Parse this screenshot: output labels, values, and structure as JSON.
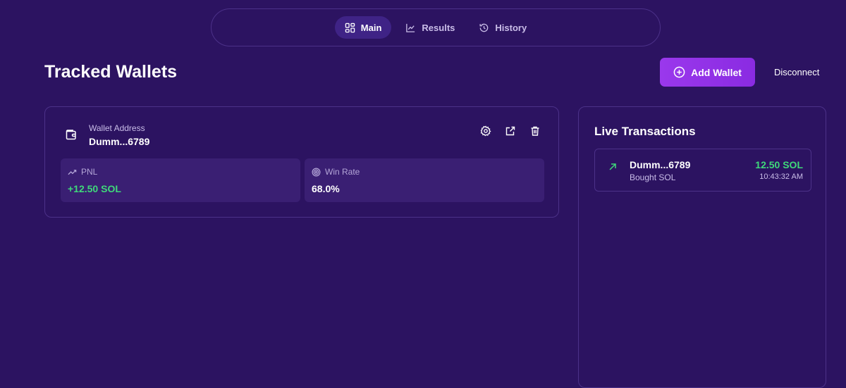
{
  "nav": {
    "tabs": [
      {
        "label": "Main",
        "icon": "dashboard-icon",
        "active": true
      },
      {
        "label": "Results",
        "icon": "chart-line-icon",
        "active": false
      },
      {
        "label": "History",
        "icon": "history-icon",
        "active": false
      }
    ]
  },
  "header": {
    "title": "Tracked Wallets",
    "add_wallet_label": "Add Wallet",
    "disconnect_label": "Disconnect"
  },
  "wallet_card": {
    "address_label": "Wallet Address",
    "address": "Dumm...6789",
    "actions": [
      "settings-icon",
      "external-link-icon",
      "trash-icon"
    ],
    "pnl_label": "PNL",
    "pnl_value": "+12.50 SOL",
    "win_rate_label": "Win Rate",
    "win_rate_value": "68.0%"
  },
  "live_transactions": {
    "title": "Live Transactions",
    "items": [
      {
        "wallet": "Dumm...6789",
        "action": "Bought SOL",
        "amount": "12.50 SOL",
        "time": "10:43:32 AM"
      }
    ]
  },
  "colors": {
    "background": "#2c1361",
    "accent": "#9a38ec",
    "positive": "#3fd97a",
    "border": "#4c3189"
  }
}
